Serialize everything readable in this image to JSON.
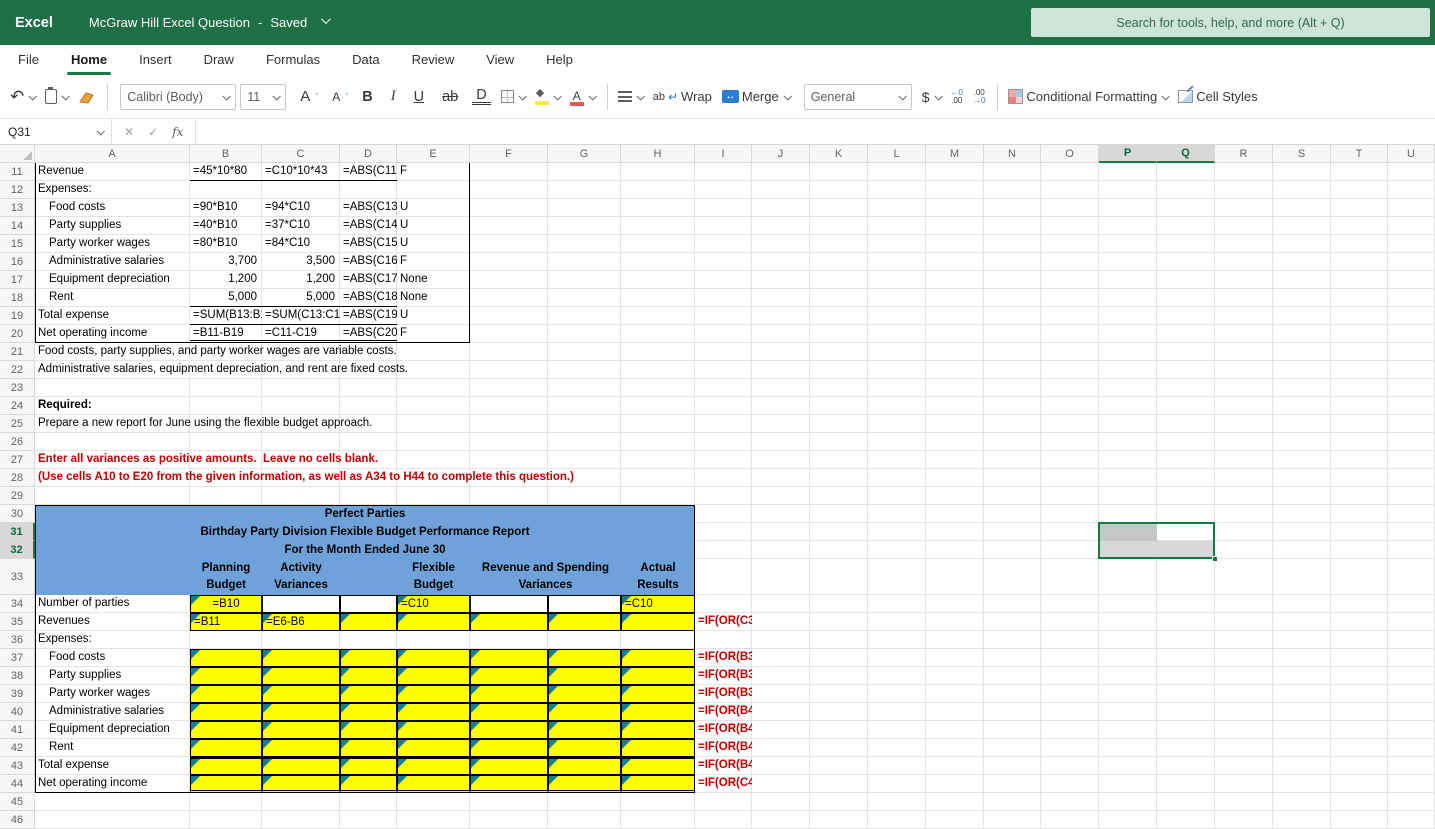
{
  "titlebar": {
    "app": "Excel",
    "doc_title": "McGraw Hill Excel Question",
    "separator": "-",
    "status": "Saved",
    "search_placeholder": "Search for tools, help, and more (Alt + Q)"
  },
  "ribbon": {
    "tabs": [
      "File",
      "Home",
      "Insert",
      "Draw",
      "Formulas",
      "Data",
      "Review",
      "View",
      "Help"
    ],
    "active_tab": "Home",
    "font_name": "Calibri (Body)",
    "font_size": "11",
    "bold_label": "B",
    "italic_label": "I",
    "underline_label": "U",
    "strikethrough_label": "ab",
    "double_underline_label": "D",
    "wrap_label": "Wrap",
    "merge_label": "Merge",
    "number_format": "General",
    "dollar_label": "$",
    "increase_decimal_label": "←0\n.00",
    "decrease_decimal_label": ".00\n→0",
    "conditional_formatting_label": "Conditional Formatting",
    "cell_styles_label": "Cell Styles",
    "wrap_arrow": "↵",
    "merge_glyph": "↔",
    "grow_font_label": "A",
    "shrink_font_label": "A",
    "undo_glyph": "↶"
  },
  "formula_bar": {
    "name_box": "Q31",
    "cancel_glyph": "✕",
    "enter_glyph": "✓",
    "fx_glyph": "fx",
    "formula": ""
  },
  "sheet": {
    "geometry": {
      "row_header_w": 35,
      "col_header_h": 18,
      "first_row": 11,
      "last_row": 46,
      "default_row_h": 18,
      "tall_rows": {
        "33": 36
      },
      "columns": [
        [
          "A",
          155
        ],
        [
          "B",
          72
        ],
        [
          "C",
          78
        ],
        [
          "D",
          57
        ],
        [
          "E",
          73
        ],
        [
          "F",
          78
        ],
        [
          "G",
          73
        ],
        [
          "H",
          74
        ],
        [
          "I",
          57
        ],
        [
          "J",
          58
        ],
        [
          "K",
          58
        ],
        [
          "L",
          58
        ],
        [
          "M",
          58
        ],
        [
          "N",
          57
        ],
        [
          "O",
          58
        ],
        [
          "P",
          58
        ],
        [
          "Q",
          58
        ],
        [
          "R",
          58
        ],
        [
          "S",
          58
        ],
        [
          "T",
          57
        ],
        [
          "U",
          47
        ]
      ]
    },
    "colors": {
      "blue_header": "#6fa2d9",
      "input_yellow": "#ffff00",
      "triangle_teal": "#12808e",
      "instruction_red": "#c00000",
      "selection_green": "#107c41",
      "shade_dark": "#c6c6c6",
      "shade_light": "#d8d8d8"
    },
    "cells": [
      {
        "a": "A11",
        "t": "Revenue"
      },
      {
        "a": "B11",
        "t": "=45*10*80",
        "bd": [
          "B"
        ]
      },
      {
        "a": "C11",
        "t": "=C10*10*43",
        "bd": [
          "B"
        ]
      },
      {
        "a": "D11",
        "t": "=ABS(C11-",
        "bd": [
          "B"
        ],
        "clip": 1
      },
      {
        "a": "E11",
        "t": "F",
        "bd": [
          "R"
        ]
      },
      {
        "a": "A12",
        "t": "Expenses:"
      },
      {
        "a": "E12",
        "t": "",
        "bd": [
          "R"
        ]
      },
      {
        "a": "A13",
        "t": "Food costs",
        "ind": 1
      },
      {
        "a": "B13",
        "t": "=90*B10"
      },
      {
        "a": "C13",
        "t": "=94*C10"
      },
      {
        "a": "D13",
        "t": "=ABS(C13-",
        "clip": 1
      },
      {
        "a": "E13",
        "t": "U",
        "bd": [
          "R"
        ]
      },
      {
        "a": "A14",
        "t": "Party supplies",
        "ind": 1
      },
      {
        "a": "B14",
        "t": "=40*B10"
      },
      {
        "a": "C14",
        "t": "=37*C10"
      },
      {
        "a": "D14",
        "t": "=ABS(C14-",
        "clip": 1
      },
      {
        "a": "E14",
        "t": "U",
        "bd": [
          "R"
        ]
      },
      {
        "a": "A15",
        "t": "Party worker wages",
        "ind": 1
      },
      {
        "a": "B15",
        "t": "=80*B10"
      },
      {
        "a": "C15",
        "t": "=84*C10"
      },
      {
        "a": "D15",
        "t": "=ABS(C15-",
        "clip": 1
      },
      {
        "a": "E15",
        "t": "U",
        "bd": [
          "R"
        ]
      },
      {
        "a": "A16",
        "t": "Administrative salaries",
        "ind": 1
      },
      {
        "a": "B16",
        "t": "3,700",
        "al": "r"
      },
      {
        "a": "C16",
        "t": "3,500",
        "al": "r"
      },
      {
        "a": "D16",
        "t": "=ABS(C16-",
        "clip": 1
      },
      {
        "a": "E16",
        "t": "F",
        "bd": [
          "R"
        ]
      },
      {
        "a": "A17",
        "t": "Equipment depreciation",
        "ind": 1
      },
      {
        "a": "B17",
        "t": "1,200",
        "al": "r"
      },
      {
        "a": "C17",
        "t": "1,200",
        "al": "r"
      },
      {
        "a": "D17",
        "t": "=ABS(C17-",
        "clip": 1
      },
      {
        "a": "E17",
        "t": "None",
        "bd": [
          "R"
        ]
      },
      {
        "a": "A18",
        "t": "Rent",
        "ind": 1
      },
      {
        "a": "B18",
        "t": "5,000",
        "al": "r",
        "bd": [
          "B"
        ]
      },
      {
        "a": "C18",
        "t": "5,000",
        "al": "r",
        "bd": [
          "B"
        ]
      },
      {
        "a": "D18",
        "t": "=ABS(C18-",
        "clip": 1,
        "bd": [
          "B"
        ]
      },
      {
        "a": "E18",
        "t": "None",
        "bd": [
          "R"
        ]
      },
      {
        "a": "A19",
        "t": "Total expense"
      },
      {
        "a": "B19",
        "t": "=SUM(B13:B1",
        "clip": 1,
        "bd": [
          "B"
        ]
      },
      {
        "a": "C19",
        "t": "=SUM(C13:C1",
        "clip": 1,
        "bd": [
          "B"
        ]
      },
      {
        "a": "D19",
        "t": "=ABS(C19-",
        "clip": 1,
        "bd": [
          "B"
        ]
      },
      {
        "a": "E19",
        "t": "U",
        "bd": [
          "R"
        ]
      },
      {
        "a": "A20",
        "t": "Net operating income"
      },
      {
        "a": "B20",
        "t": "=B11-B19",
        "bd": [
          "B2"
        ]
      },
      {
        "a": "C20",
        "t": "=C11-C19",
        "bd": [
          "B2"
        ]
      },
      {
        "a": "D20",
        "t": "=ABS(C20-",
        "clip": 1,
        "bd": [
          "B2"
        ]
      },
      {
        "a": "E20",
        "t": "F",
        "bd": [
          "R"
        ]
      },
      {
        "a": "A21",
        "t": "Food costs, party supplies, and party worker wages are variable costs.",
        "spill": 1
      },
      {
        "a": "A22",
        "t": "Administrative salaries, equipment depreciation, and rent are fixed costs.",
        "spill": 1
      },
      {
        "a": "A24",
        "t": "Required:",
        "b": 1
      },
      {
        "a": "A25",
        "t": "Prepare a new report for June using the flexible budget approach.",
        "spill": 1
      },
      {
        "a": "A27",
        "t": "Enter all variances as positive amounts.  Leave no cells blank.",
        "b": 1,
        "red": 1,
        "spill": 1
      },
      {
        "a": "A28",
        "t": "(Use cells A10 to E20 from the given information, as well as A34 to H44 to complete this question.)",
        "b": 1,
        "red": 1,
        "spill": 1
      },
      {
        "a": "A34",
        "t": "Number of parties"
      },
      {
        "a": "B34",
        "t": "=B10",
        "al": "c",
        "bg": "y",
        "bd": [
          "A"
        ],
        "tri": 1
      },
      {
        "a": "C34",
        "t": "",
        "bg": "w",
        "bd": [
          "A"
        ]
      },
      {
        "a": "D34",
        "t": "",
        "bg": "w",
        "bd": [
          "A"
        ]
      },
      {
        "a": "E34",
        "t": "=C10",
        "bg": "y",
        "bd": [
          "A"
        ],
        "tri": 1
      },
      {
        "a": "F34",
        "t": "",
        "bg": "w",
        "bd": [
          "A"
        ]
      },
      {
        "a": "G34",
        "t": "",
        "bg": "w",
        "bd": [
          "A"
        ]
      },
      {
        "a": "H34",
        "t": "=C10",
        "bg": "y",
        "bd": [
          "A"
        ],
        "tri": 1
      },
      {
        "a": "A35",
        "t": "Revenues"
      },
      {
        "a": "B35",
        "t": "=B11",
        "bg": "y",
        "bd": [
          "A"
        ],
        "tri": 1
      },
      {
        "a": "C35",
        "t": "=E6-B6",
        "bg": "y",
        "bd": [
          "A"
        ],
        "tri": 1
      },
      {
        "a": "D35:H35",
        "t": "",
        "bg": "y",
        "bd": [
          "A"
        ],
        "tri": 1
      },
      {
        "a": "I35",
        "t": "=IF(OR(C3",
        "b": 1,
        "red": 1,
        "clip": 1
      },
      {
        "a": "A36",
        "t": "Expenses:"
      },
      {
        "a": "A37",
        "t": "Food costs",
        "ind": 1
      },
      {
        "a": "B37:H37",
        "t": "",
        "bg": "y",
        "bd": [
          "A"
        ],
        "tri": 1
      },
      {
        "a": "I37",
        "t": "=IF(OR(B3",
        "b": 1,
        "red": 1,
        "clip": 1
      },
      {
        "a": "A38",
        "t": "Party supplies",
        "ind": 1
      },
      {
        "a": "B38:H38",
        "t": "",
        "bg": "y",
        "bd": [
          "A"
        ],
        "tri": 1
      },
      {
        "a": "I38",
        "t": "=IF(OR(B3",
        "b": 1,
        "red": 1,
        "clip": 1
      },
      {
        "a": "A39",
        "t": "Party worker wages",
        "ind": 1
      },
      {
        "a": "B39:H39",
        "t": "",
        "bg": "y",
        "bd": [
          "A"
        ],
        "tri": 1
      },
      {
        "a": "I39",
        "t": "=IF(OR(B3",
        "b": 1,
        "red": 1,
        "clip": 1
      },
      {
        "a": "A40",
        "t": "Administrative salaries",
        "ind": 1
      },
      {
        "a": "B40:H40",
        "t": "",
        "bg": "y",
        "bd": [
          "A"
        ],
        "tri": 1
      },
      {
        "a": "I40",
        "t": "=IF(OR(B4",
        "b": 1,
        "red": 1,
        "clip": 1
      },
      {
        "a": "A41",
        "t": "Equipment depreciation",
        "ind": 1
      },
      {
        "a": "B41:H41",
        "t": "",
        "bg": "y",
        "bd": [
          "A"
        ],
        "tri": 1
      },
      {
        "a": "I41",
        "t": "=IF(OR(B4",
        "b": 1,
        "red": 1,
        "clip": 1
      },
      {
        "a": "A42",
        "t": "Rent",
        "ind": 1
      },
      {
        "a": "B42:H42",
        "t": "",
        "bg": "y",
        "bd": [
          "A"
        ],
        "tri": 1
      },
      {
        "a": "I42",
        "t": "=IF(OR(B4",
        "b": 1,
        "red": 1,
        "clip": 1
      },
      {
        "a": "A43",
        "t": "Total expense"
      },
      {
        "a": "B43:H43",
        "t": "",
        "bg": "y",
        "bd": [
          "A",
          "T2"
        ],
        "tri": 1
      },
      {
        "a": "I43",
        "t": "=IF(OR(B4",
        "b": 1,
        "red": 1,
        "clip": 1
      },
      {
        "a": "A44",
        "t": "Net operating income"
      },
      {
        "a": "B44:H44",
        "t": "",
        "bg": "y",
        "bd": [
          "A",
          "B2"
        ],
        "tri": 1
      },
      {
        "a": "I44",
        "t": "=IF(OR(C4",
        "b": 1,
        "red": 1,
        "clip": 1
      }
    ],
    "report_header": {
      "range": "A30:H33",
      "title_lines": [
        {
          "row": 30,
          "text": "Perfect Parties"
        },
        {
          "row": 31,
          "text": "Birthday Party Division Flexible Budget Performance Report"
        },
        {
          "row": 32,
          "text": "For the Month Ended June 30"
        }
      ],
      "header_row": 33,
      "column_headers": [
        {
          "cols": "B:B",
          "lines": [
            "Planning",
            "Budget"
          ]
        },
        {
          "cols": "C:C",
          "lines": [
            "Activity",
            "Variances"
          ]
        },
        {
          "cols": "E:E",
          "lines": [
            "Flexible",
            "Budget"
          ]
        },
        {
          "cols": "F:G",
          "lines": [
            "Revenue and Spending",
            "Variances"
          ]
        },
        {
          "cols": "H:H",
          "lines": [
            "Actual",
            "Results"
          ]
        }
      ]
    },
    "rules": [
      {
        "type": "vline",
        "col_left": "A",
        "r1": 11,
        "r2": 20
      },
      {
        "type": "hline",
        "c1": "A",
        "c2": "E",
        "below_row": 20
      }
    ],
    "outline_range": "A30:H44",
    "selection": {
      "range": "P31:Q32",
      "active_cell": "Q31",
      "shaded": [
        {
          "ref": "P31",
          "tone": "dark"
        },
        {
          "ref": "P32",
          "tone": "light"
        },
        {
          "ref": "Q32",
          "tone": "light"
        }
      ],
      "highlight_cols": [
        "P",
        "Q"
      ],
      "highlight_rows": [
        31,
        32
      ]
    }
  }
}
